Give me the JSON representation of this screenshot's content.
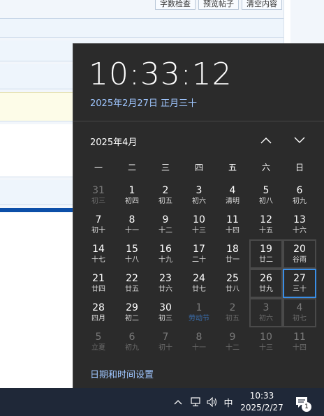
{
  "background": {
    "toolbar_buttons": [
      "字数检查",
      "预览帖子",
      "清空内容"
    ]
  },
  "flyout": {
    "time": "10:33:12",
    "date_line": "2025年2月27日 正月三十",
    "month_title": "2025年4月",
    "weekdays": [
      "一",
      "二",
      "三",
      "四",
      "五",
      "六",
      "日"
    ],
    "weeks": [
      [
        {
          "day": "31",
          "lunar": "初三",
          "state": "dim"
        },
        {
          "day": "1",
          "lunar": "初四"
        },
        {
          "day": "2",
          "lunar": "初五"
        },
        {
          "day": "3",
          "lunar": "初六"
        },
        {
          "day": "4",
          "lunar": "清明"
        },
        {
          "day": "5",
          "lunar": "初八"
        },
        {
          "day": "6",
          "lunar": "初九"
        }
      ],
      [
        {
          "day": "7",
          "lunar": "初十"
        },
        {
          "day": "8",
          "lunar": "十一"
        },
        {
          "day": "9",
          "lunar": "十二"
        },
        {
          "day": "10",
          "lunar": "十三"
        },
        {
          "day": "11",
          "lunar": "十四"
        },
        {
          "day": "12",
          "lunar": "十五"
        },
        {
          "day": "13",
          "lunar": "十六"
        }
      ],
      [
        {
          "day": "14",
          "lunar": "十七"
        },
        {
          "day": "15",
          "lunar": "十八"
        },
        {
          "day": "16",
          "lunar": "十九"
        },
        {
          "day": "17",
          "lunar": "二十"
        },
        {
          "day": "18",
          "lunar": "廿一"
        },
        {
          "day": "19",
          "lunar": "廿二",
          "state": "boxed"
        },
        {
          "day": "20",
          "lunar": "谷雨",
          "state": "boxed"
        }
      ],
      [
        {
          "day": "21",
          "lunar": "廿四"
        },
        {
          "day": "22",
          "lunar": "廿五"
        },
        {
          "day": "23",
          "lunar": "廿六"
        },
        {
          "day": "24",
          "lunar": "廿七"
        },
        {
          "day": "25",
          "lunar": "廿八"
        },
        {
          "day": "26",
          "lunar": "廿九",
          "state": "boxed"
        },
        {
          "day": "27",
          "lunar": "三十",
          "state": "today"
        }
      ],
      [
        {
          "day": "28",
          "lunar": "四月"
        },
        {
          "day": "29",
          "lunar": "初二"
        },
        {
          "day": "30",
          "lunar": "初三"
        },
        {
          "day": "1",
          "lunar": "劳动节",
          "state": "dim festival"
        },
        {
          "day": "2",
          "lunar": "初五",
          "state": "dim"
        },
        {
          "day": "3",
          "lunar": "初六",
          "state": "dim boxed"
        },
        {
          "day": "4",
          "lunar": "初七",
          "state": "dim boxed"
        }
      ],
      [
        {
          "day": "5",
          "lunar": "立夏",
          "state": "dim"
        },
        {
          "day": "6",
          "lunar": "初九",
          "state": "dim"
        },
        {
          "day": "7",
          "lunar": "初十",
          "state": "dim"
        },
        {
          "day": "8",
          "lunar": "十一",
          "state": "dim"
        },
        {
          "day": "9",
          "lunar": "十二",
          "state": "dim"
        },
        {
          "day": "10",
          "lunar": "十三",
          "state": "dim"
        },
        {
          "day": "11",
          "lunar": "十四",
          "state": "dim"
        }
      ]
    ],
    "settings_link": "日期和时间设置"
  },
  "taskbar": {
    "ime": "中",
    "time": "10:33",
    "date": "2025/2/27",
    "notification_count": "1"
  },
  "icons": [
    "chevron-up-icon",
    "chevron-down-icon",
    "tray-expand-icon",
    "network-icon",
    "volume-icon",
    "notification-icon"
  ],
  "colors": {
    "flyout_bg": "#2b2b2b",
    "accent_link": "#9fc6ff",
    "today_border": "#3a8ee6",
    "taskbar_bg": "#1f2838"
  }
}
